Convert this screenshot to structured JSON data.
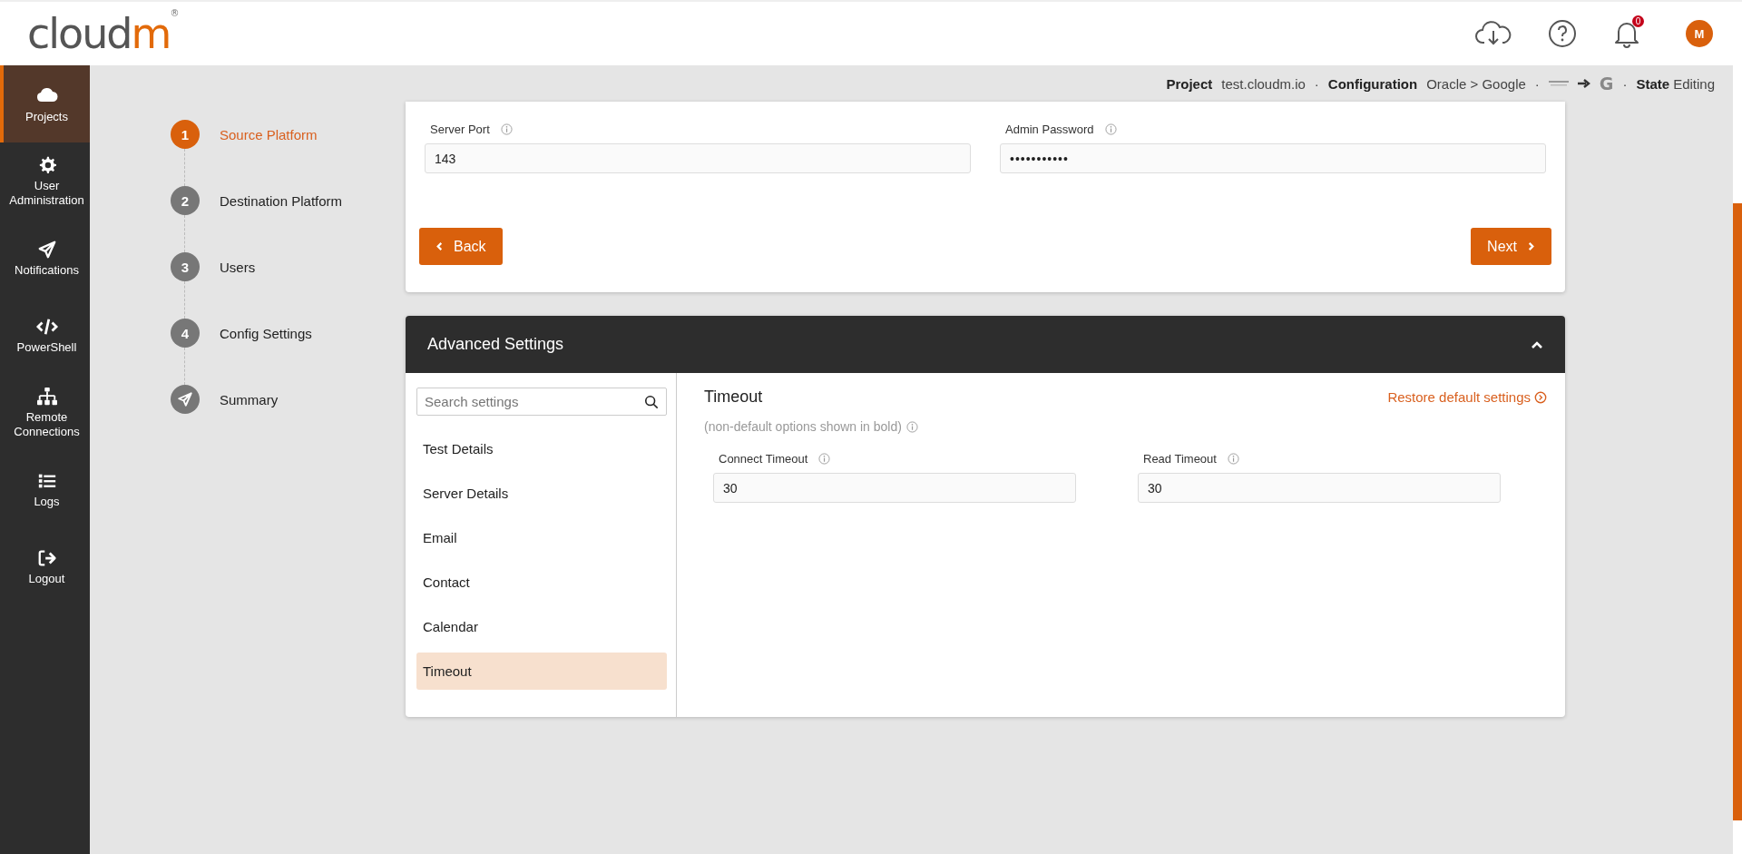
{
  "header": {
    "logo": {
      "main": "cloud",
      "accent": "m",
      "mark": "®"
    },
    "notification_count": "0",
    "avatar": "M"
  },
  "sidebar": {
    "items": [
      {
        "label": "Projects",
        "selected": true
      },
      {
        "label": "User Administration",
        "selected": false
      },
      {
        "label": "Notifications",
        "selected": false
      },
      {
        "label": "PowerShell",
        "selected": false
      },
      {
        "label": "Remote Connections",
        "selected": false
      },
      {
        "label": "Logs",
        "selected": false
      },
      {
        "label": "Logout",
        "selected": false
      }
    ]
  },
  "breadcrumb": {
    "project_label": "Project",
    "project": "test.cloudm.io",
    "configuration_label": "Configuration",
    "configuration": "Oracle > Google",
    "destination_logo": "G",
    "state_label": "State",
    "state": "Editing",
    "separator": "·"
  },
  "steps": [
    {
      "number": "1",
      "label": "Source Platform",
      "kind": "number",
      "selected": true
    },
    {
      "number": "2",
      "label": "Destination Platform",
      "kind": "number",
      "selected": false
    },
    {
      "number": "3",
      "label": "Users",
      "kind": "number",
      "selected": false
    },
    {
      "number": "4",
      "label": "Config Settings",
      "kind": "number",
      "selected": false
    },
    {
      "label": "Summary",
      "kind": "icon",
      "selected": false
    }
  ],
  "source_form": {
    "fields": [
      {
        "label": "Server Port",
        "value": "143"
      },
      {
        "label": "Admin Password",
        "value": "•••••••••••"
      }
    ],
    "back_button": "Back",
    "next_button": "Next"
  },
  "advanced_settings": {
    "title": "Advanced Settings",
    "expanded": true,
    "search": {
      "placeholder": "Search settings"
    },
    "categories": [
      {
        "label": "Test Details",
        "selected": false
      },
      {
        "label": "Server Details",
        "selected": false
      },
      {
        "label": "Email",
        "selected": false
      },
      {
        "label": "Contact",
        "selected": false
      },
      {
        "label": "Calendar",
        "selected": false
      },
      {
        "label": "Timeout",
        "selected": true
      }
    ],
    "section_title": "Timeout",
    "restore_link": "Restore default settings",
    "note": "(non-default options shown in bold)",
    "fields": [
      {
        "label": "Connect Timeout",
        "value": "30"
      },
      {
        "label": "Read Timeout",
        "value": "30"
      }
    ]
  }
}
